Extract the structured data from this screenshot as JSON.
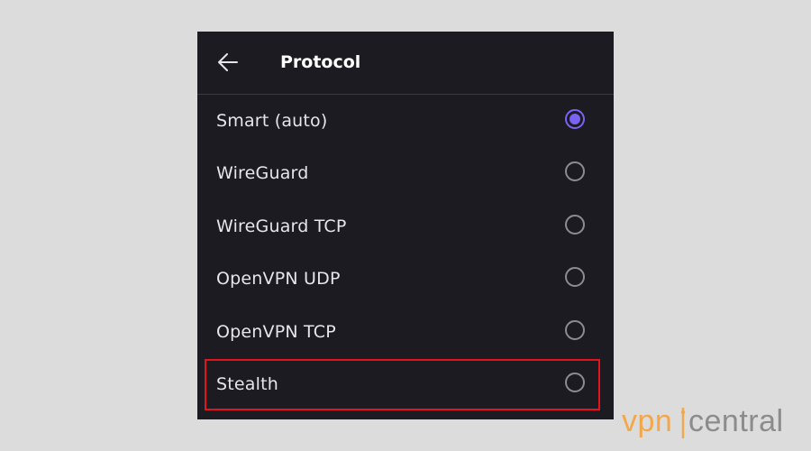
{
  "header": {
    "title": "Protocol"
  },
  "protocols": [
    {
      "label": "Smart (auto)",
      "selected": true
    },
    {
      "label": "WireGuard",
      "selected": false
    },
    {
      "label": "WireGuard TCP",
      "selected": false
    },
    {
      "label": "OpenVPN UDP",
      "selected": false
    },
    {
      "label": "OpenVPN TCP",
      "selected": false
    },
    {
      "label": "Stealth",
      "selected": false,
      "highlighted": true
    }
  ],
  "watermark": {
    "text": "vpncentral"
  },
  "colors": {
    "background": "#dcdcdc",
    "panel": "#1b1b21",
    "accent": "#7a63f2",
    "highlight_border": "#e3141b",
    "watermark_orange": "#f2a84a"
  }
}
